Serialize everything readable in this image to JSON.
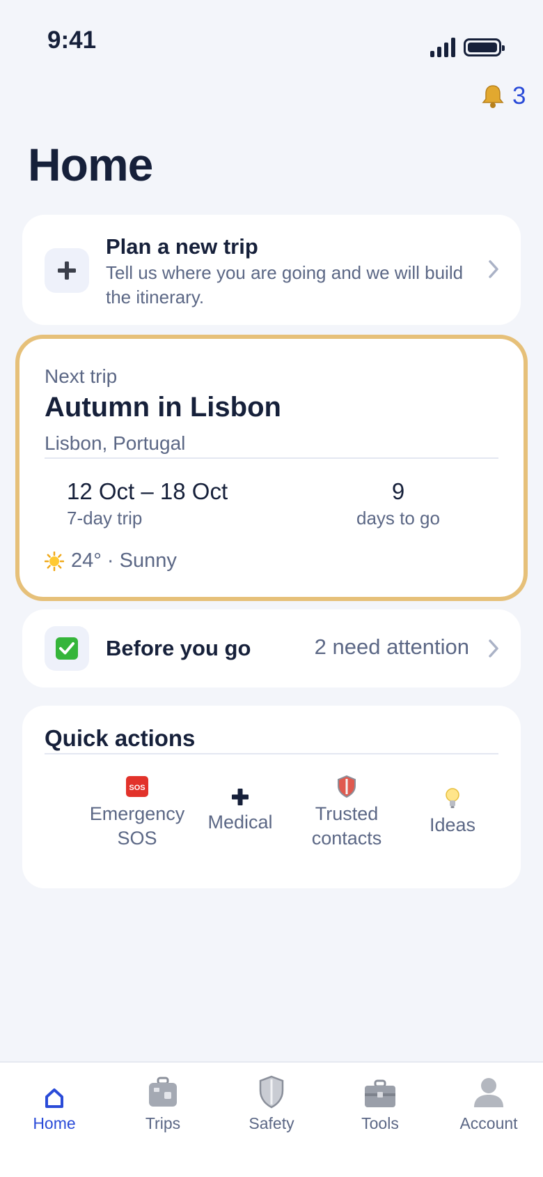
{
  "status_bar": {
    "time": "9:41"
  },
  "notifications": {
    "count": "3",
    "icon": "bell-icon"
  },
  "page": {
    "title": "Home"
  },
  "plan_card": {
    "title": "Plan a new trip",
    "description": "Tell us where you are going and we will build the itinerary.",
    "icon": "plus-icon"
  },
  "next_trip": {
    "label": "Next trip",
    "title": "Autumn in Lisbon",
    "location": "Lisbon, Portugal",
    "dates": "12 Oct – 18 Oct",
    "length": "7-day trip",
    "days_to_go": "9",
    "days_to_go_label": "days to go",
    "weather": "24° · Sunny",
    "weather_icon": "sun-icon",
    "highlight_color": "#e6c079"
  },
  "before_you_go": {
    "title": "Before you go",
    "status": "2 need attention",
    "icon": "check-box-icon"
  },
  "quick_actions": {
    "title": "Quick actions",
    "items": [
      {
        "label": "Emergency SOS",
        "icon": "sos-icon"
      },
      {
        "label": "Medical",
        "icon": "medical-cross-icon"
      },
      {
        "label": "Trusted contacts",
        "icon": "shield-icon"
      },
      {
        "label": "Ideas",
        "icon": "lightbulb-icon"
      }
    ]
  },
  "tabs": [
    {
      "label": "Home",
      "icon": "home-icon",
      "active": true
    },
    {
      "label": "Trips",
      "icon": "luggage-icon",
      "active": false
    },
    {
      "label": "Safety",
      "icon": "shield-icon",
      "active": false
    },
    {
      "label": "Tools",
      "icon": "toolbox-icon",
      "active": false
    },
    {
      "label": "Account",
      "icon": "person-icon",
      "active": false
    }
  ],
  "colors": {
    "background": "#f3f5fa",
    "accent": "#2a4bd8",
    "text_primary": "#16203a",
    "text_secondary": "#5b6785"
  }
}
